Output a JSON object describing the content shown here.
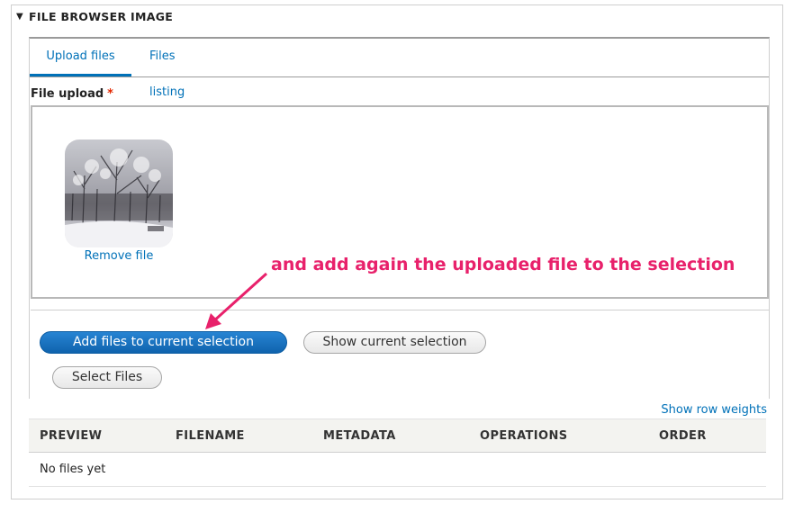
{
  "fieldset": {
    "legend": "FILE BROWSER IMAGE",
    "toggle_icon": "triangle-down"
  },
  "tabs": [
    {
      "label": "Upload files",
      "active": true
    },
    {
      "label": "Files listing",
      "active": false
    }
  ],
  "upload": {
    "label": "File upload",
    "required_marker": "*",
    "thumbnail": {
      "description_icon": "snowy-forest-image"
    },
    "remove_label": "Remove file"
  },
  "buttons": {
    "add_selection": "Add files to current selection",
    "show_selection": "Show current selection",
    "select_files": "Select Files"
  },
  "annotation": {
    "text": "and add again the uploaded file to the selection",
    "color": "#e8216b"
  },
  "table": {
    "show_row_weights": "Show row weights",
    "headers": [
      "PREVIEW",
      "FILENAME",
      "METADATA",
      "OPERATIONS",
      "ORDER"
    ],
    "empty_message": "No files yet"
  },
  "colors": {
    "link": "#0071b8",
    "primary_button": "#1671bf",
    "required": "#e32700"
  }
}
